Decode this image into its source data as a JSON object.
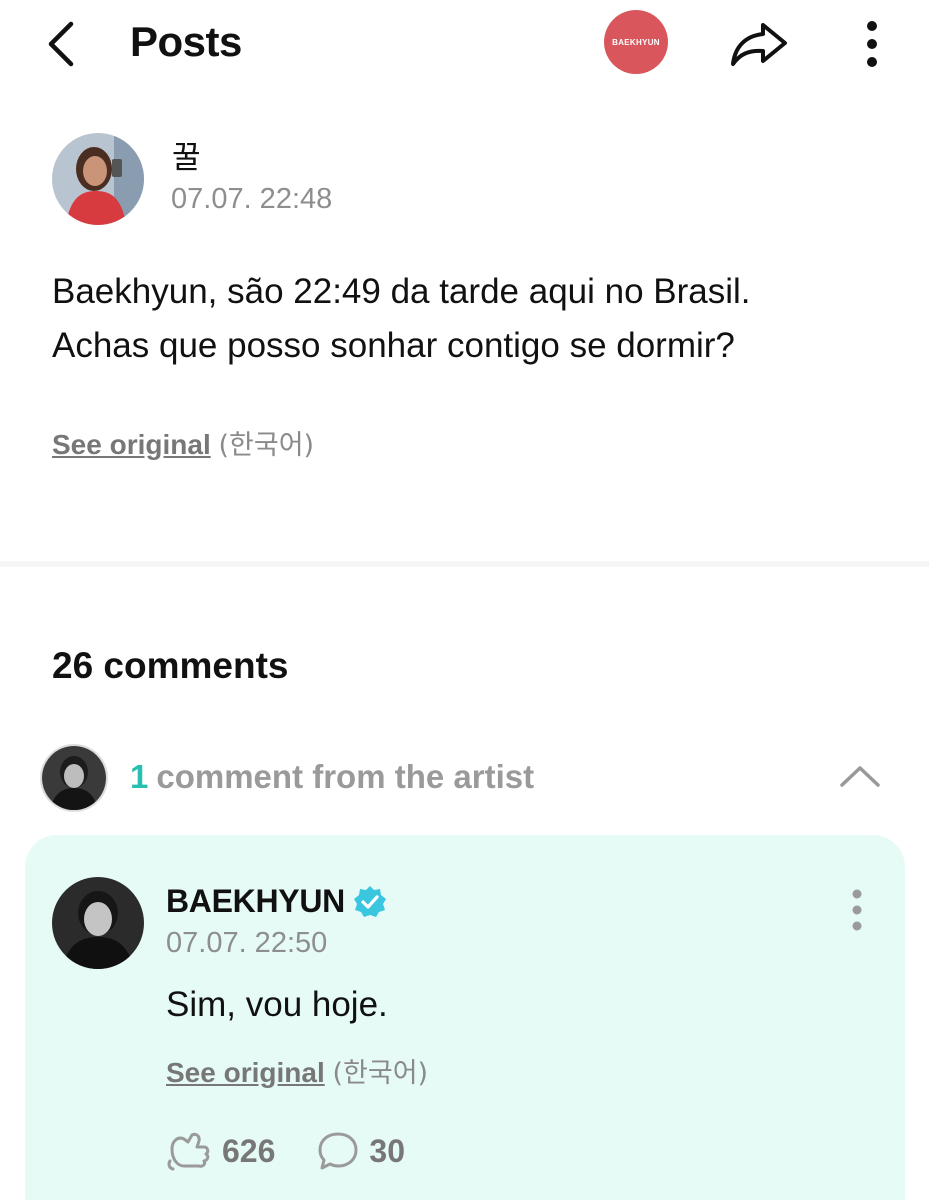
{
  "header": {
    "title": "Posts",
    "artist_badge": "BAEKHYUN",
    "icons": [
      "back-arrow-icon",
      "share-icon",
      "more-vertical-icon"
    ]
  },
  "post": {
    "author": "꿀",
    "time": "07.07. 22:48",
    "body_line1": "Baekhyun, são 22:49 da tarde aqui no Brasil.",
    "body_line2": "Achas que posso sonhar contigo se dormir?",
    "see_original": "See original",
    "original_lang": "(한국어)"
  },
  "comments": {
    "count_label": "26 comments",
    "artist_section": {
      "count": "1",
      "label": "comment from the artist"
    }
  },
  "artist_comment": {
    "name": "BAEKHYUN",
    "verified": true,
    "time": "07.07. 22:50",
    "body": "Sim, vou hoje.",
    "see_original": "See original",
    "original_lang": "(한국어)",
    "likes": "626",
    "replies": "30"
  },
  "colors": {
    "accent": "#27c0b0",
    "badge": "#d9575c",
    "card_bg": "#e6fbf6",
    "verified": "#3bc6e0"
  }
}
